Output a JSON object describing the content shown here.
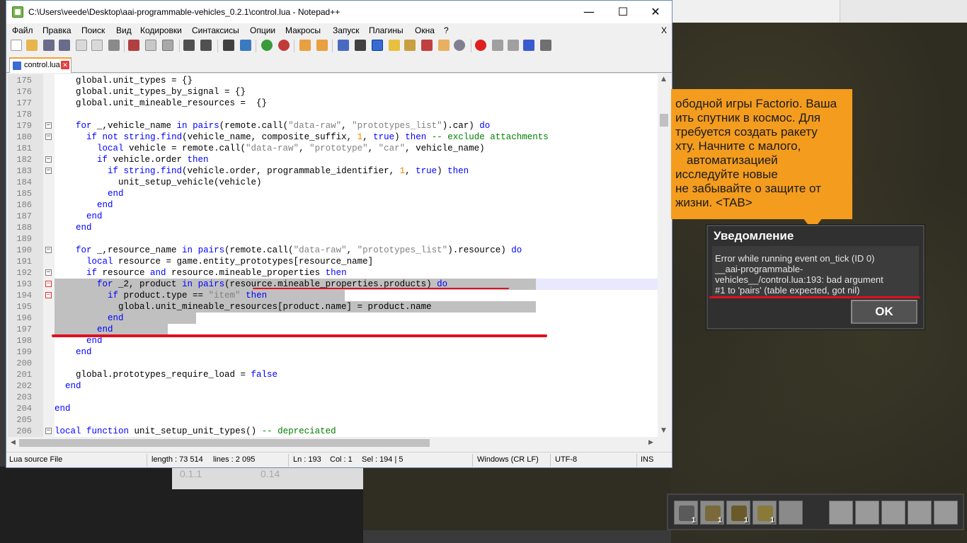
{
  "window": {
    "title": "C:\\Users\\veede\\Desktop\\aai-programmable-vehicles_0.2.1\\control.lua - Notepad++",
    "minimize_label": "—",
    "maximize_label": "☐",
    "close_label": "✕"
  },
  "menu": {
    "items": [
      "Файл",
      "Правка",
      "Поиск",
      "Вид",
      "Кодировки",
      "Синтаксисы",
      "Опции",
      "Макросы",
      "Запуск",
      "Плагины",
      "Окна",
      "?"
    ],
    "close_doc_label": "X"
  },
  "tab": {
    "label": "control.lua",
    "close_label": "✕"
  },
  "editor": {
    "lines": [
      {
        "n": "175",
        "text": "global.unit_types = {}"
      },
      {
        "n": "176",
        "text": "global.unit_types_by_signal = {}"
      },
      {
        "n": "177",
        "text": "global.unit_mineable_resources =  {}"
      },
      {
        "n": "178",
        "text": ""
      },
      {
        "n": "179",
        "text": "for _,vehicle_name in pairs(remote.call(\"data-raw\", \"prototypes_list\").car) do"
      },
      {
        "n": "180",
        "text": "if not string.find(vehicle_name, composite_suffix, 1, true) then -- exclude attachments"
      },
      {
        "n": "181",
        "text": "local vehicle = remote.call(\"data-raw\", \"prototype\", \"car\", vehicle_name)"
      },
      {
        "n": "182",
        "text": "if vehicle.order then"
      },
      {
        "n": "183",
        "text": "if string.find(vehicle.order, programmable_identifier, 1, true) then"
      },
      {
        "n": "184",
        "text": "unit_setup_vehicle(vehicle)"
      },
      {
        "n": "185",
        "text": "end"
      },
      {
        "n": "186",
        "text": "end"
      },
      {
        "n": "187",
        "text": "end"
      },
      {
        "n": "188",
        "text": "end"
      },
      {
        "n": "189",
        "text": ""
      },
      {
        "n": "190",
        "text": "for _,resource_name in pairs(remote.call(\"data-raw\", \"prototypes_list\").resource) do"
      },
      {
        "n": "191",
        "text": "local resource = game.entity_prototypes[resource_name]"
      },
      {
        "n": "192",
        "text": "if resource and resource.mineable_properties then"
      },
      {
        "n": "193",
        "text": "for _2, product in pairs(resource.mineable_properties.products) do"
      },
      {
        "n": "194",
        "text": "if product.type == \"item\" then"
      },
      {
        "n": "195",
        "text": "global.unit_mineable_resources[product.name] = product.name"
      },
      {
        "n": "196",
        "text": "end"
      },
      {
        "n": "197",
        "text": "end"
      },
      {
        "n": "198",
        "text": "end"
      },
      {
        "n": "199",
        "text": "end"
      },
      {
        "n": "200",
        "text": ""
      },
      {
        "n": "201",
        "text": "global.prototypes_require_load = false"
      },
      {
        "n": "202",
        "text": "end"
      },
      {
        "n": "203",
        "text": ""
      },
      {
        "n": "204",
        "text": "end"
      },
      {
        "n": "205",
        "text": ""
      },
      {
        "n": "206",
        "text": "local function unit_setup_unit_types() -- depreciated"
      }
    ]
  },
  "status": {
    "file_type": "Lua source File",
    "length": "length : 73 514",
    "lines": "lines : 2 095",
    "ln": "Ln : 193",
    "col": "Col : 1",
    "sel": "Sel : 194 | 5",
    "eol": "Windows (CR LF)",
    "encoding": "UTF-8",
    "mode": "INS"
  },
  "background_panel": {
    "v1": "0.1.1",
    "v2": "0.14"
  },
  "tip": {
    "lines": [
      "ободной игры Factorio. Ваша",
      "ить спутник в космос. Для",
      "требуется создать ракету",
      "хту. Начните с малого,",
      "автоматизацией",
      "исследуйте новые",
      "не забывайте о защите от",
      "жизни. <TAB>"
    ]
  },
  "dialog": {
    "title": "Уведомление",
    "message_lines": [
      "Error while running event on_tick (ID 0)",
      "__aai-programmable-",
      "vehicles__/control.lua:193: bad argument",
      "#1 to 'pairs' (table expected, got nil)"
    ],
    "ok_label": "OK"
  },
  "quickbar": {
    "counts": [
      "1",
      "1",
      "1",
      "1"
    ]
  },
  "colors": {
    "keyword": "#0000ff",
    "string": "#808080",
    "number": "#ff8000",
    "comment": "#008000",
    "annotation_red": "#e01020",
    "tip_orange": "#f39c1e"
  }
}
